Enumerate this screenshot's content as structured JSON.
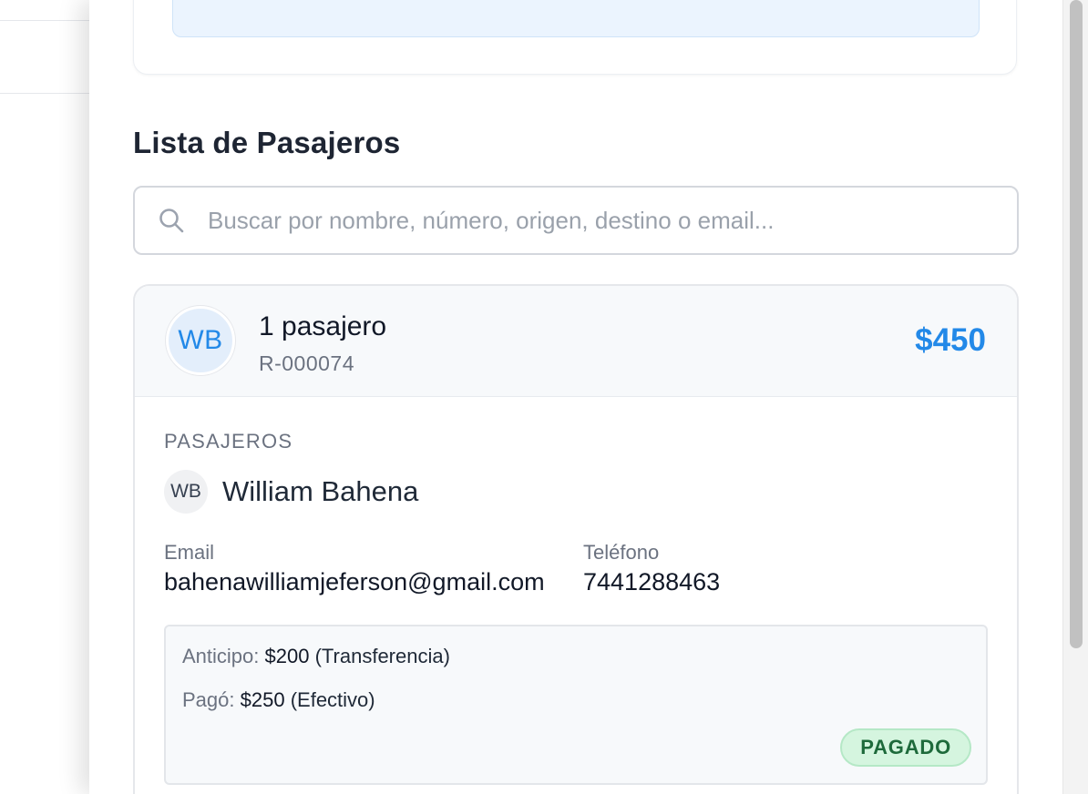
{
  "section": {
    "title": "Lista de Pasajeros"
  },
  "search": {
    "placeholder": "Buscar por nombre, número, origen, destino o email..."
  },
  "reservation": {
    "initials": "WB",
    "passenger_count_label": "1 pasajero",
    "code": "R-000074",
    "total": "$450",
    "passengers_heading": "PASAJEROS",
    "passenger": {
      "initials": "WB",
      "name": "William Bahena",
      "email_label": "Email",
      "email": "bahenawilliamjeferson@gmail.com",
      "phone_label": "Teléfono",
      "phone": "7441288463"
    },
    "payments": [
      {
        "label": "Anticipo:",
        "amount": "$200",
        "method": "(Transferencia)"
      },
      {
        "label": "Pagó:",
        "amount": "$250",
        "method": "(Efectivo)"
      }
    ],
    "status": "PAGADO"
  },
  "icons": {
    "search": "search-icon"
  },
  "colors": {
    "accent": "#2389e8",
    "status_bg": "#d5f5df",
    "status_text": "#1e6a3b"
  }
}
